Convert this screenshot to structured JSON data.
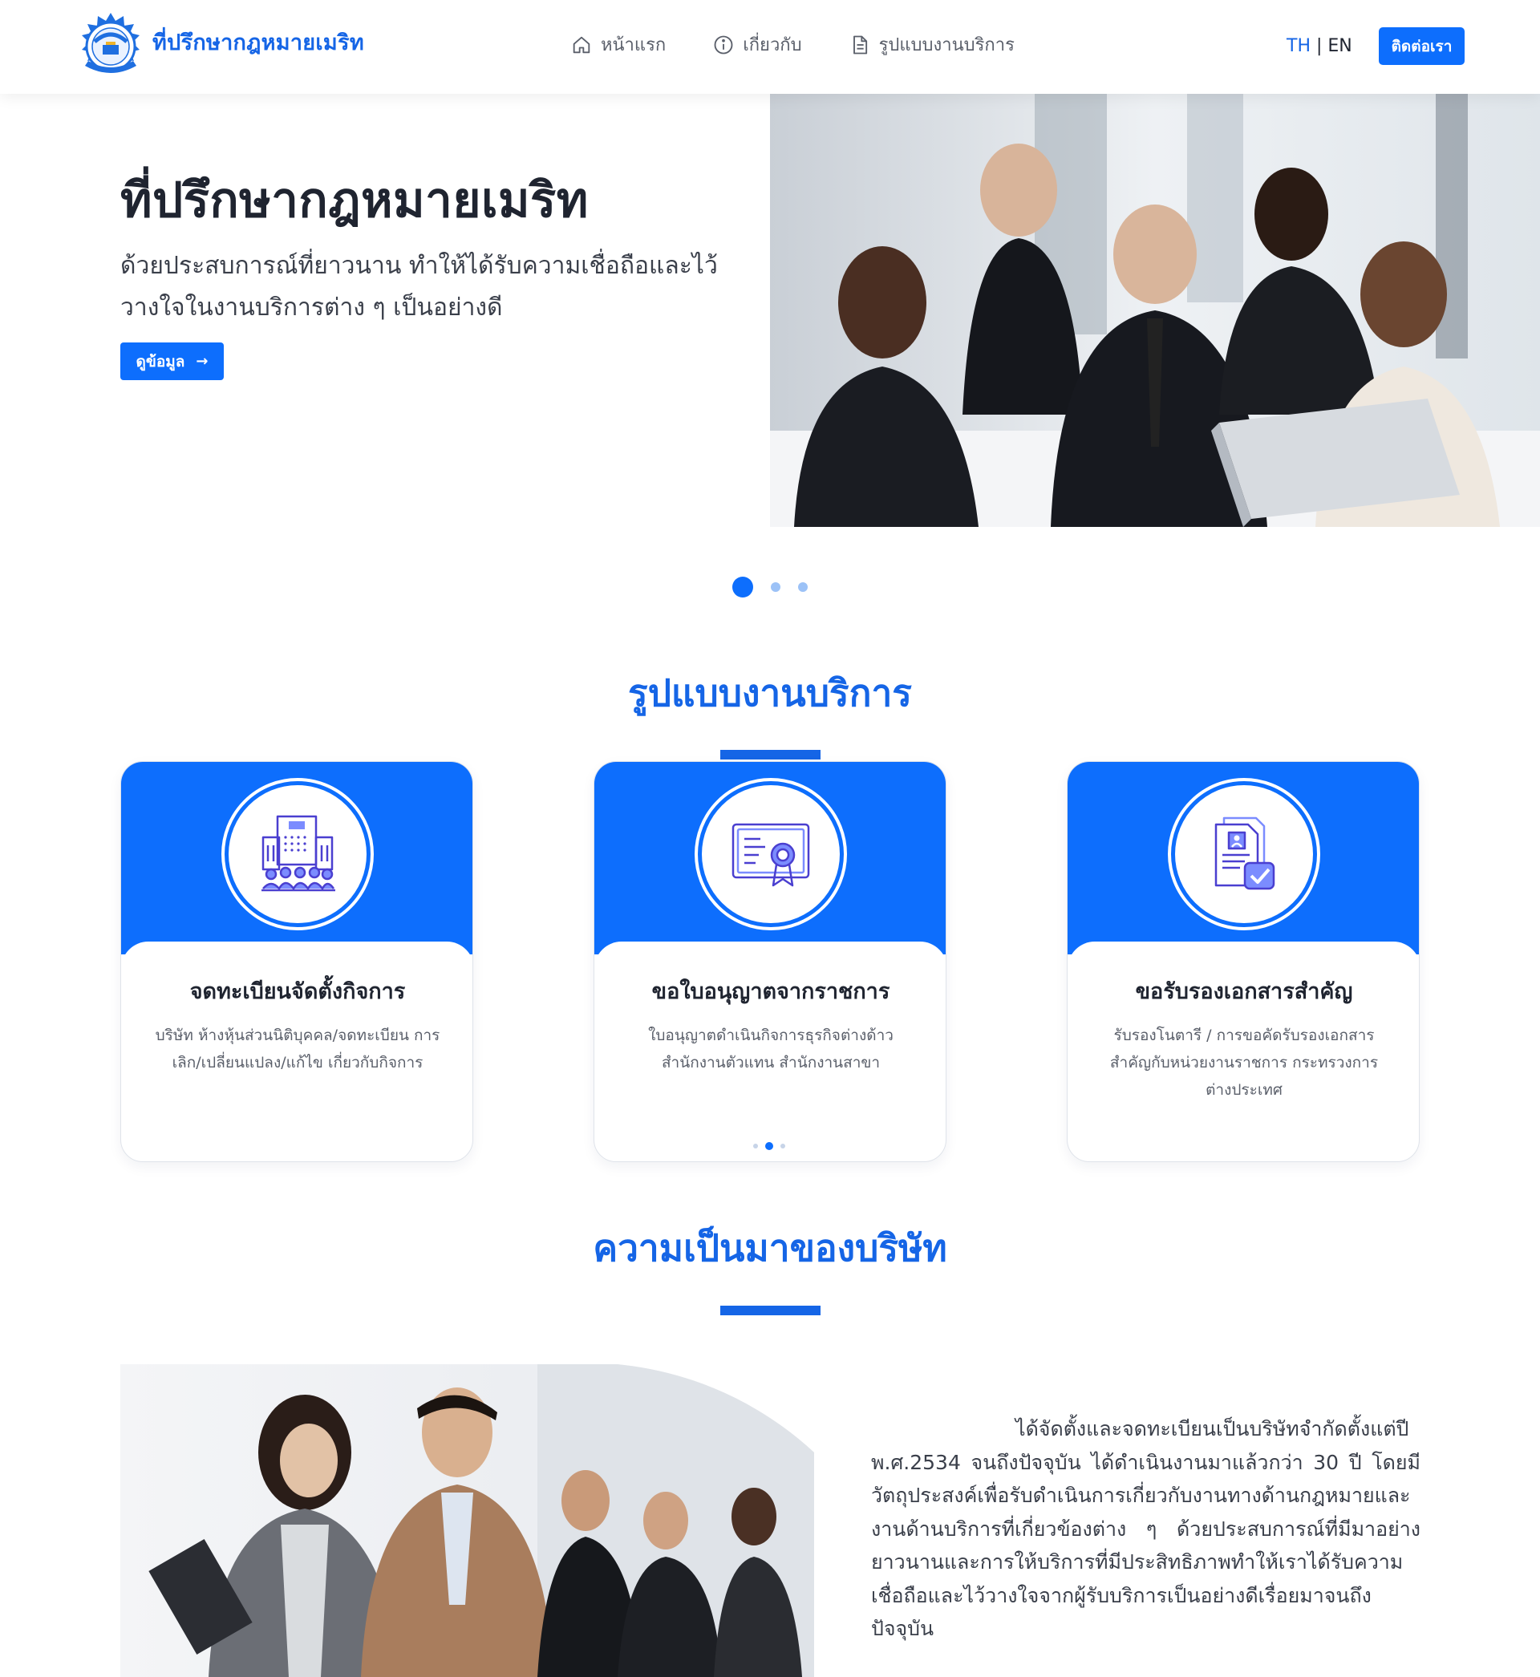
{
  "brand": {
    "name": "ที่ปรึกษากฎหมายเมริท"
  },
  "nav": {
    "items": [
      {
        "label": "หน้าแรก",
        "icon": "home-icon"
      },
      {
        "label": "เกี่ยวกับ",
        "icon": "info-icon"
      },
      {
        "label": "รูปแบบงานบริการ",
        "icon": "document-icon"
      }
    ],
    "lang_th": "TH",
    "lang_sep": "|",
    "lang_en": "EN",
    "contact_label": "ติดต่อเรา"
  },
  "hero": {
    "title": "ที่ปรึกษากฎหมายเมริท",
    "subtitle": "ด้วยประสบการณ์ที่ยาวนาน ทำให้ได้รับความเชื่อถือและไว้วางใจในงานบริการต่าง ๆ เป็นอย่างดี",
    "button_label": "ดูข้อมูล",
    "button_icon": "arrow-right-icon",
    "slides": 3,
    "active_slide": 1
  },
  "services": {
    "title": "รูปแบบงานบริการ",
    "cards": [
      {
        "title": "จดทะเบียนจัดตั้งกิจการ",
        "description": "บริษัท ห้างหุ้นส่วนนิติบุคคล/จดทะเบียน การเลิก/เปลี่ยนแปลง/แก้ไข เกี่ยวกับกิจการ",
        "icon": "company-building-icon"
      },
      {
        "title": "ขอใบอนุญาตจากราชการ",
        "description": "ใบอนุญาตดำเนินกิจการธุรกิจต่างด้าว สำนักงานตัวแทน สำนักงานสาขา",
        "icon": "certificate-icon"
      },
      {
        "title": "ขอรับรองเอกสารสำคัญ",
        "description": "รับรองโนตารี / การขอคัดรับรองเอกสารสำคัญกับหน่วยงานราชการ กระทรวงการต่างประเทศ",
        "icon": "document-approved-icon"
      }
    ],
    "pager": {
      "count": 3,
      "active": 2
    }
  },
  "about": {
    "title": "ความเป็นมาของบริษัท",
    "text": "ได้จัดตั้งและจดทะเบียนเป็นบริษัทจำกัดตั้งแต่ปี พ.ศ.2534 จนถึงปัจจุบัน ได้ดำเนินงานมาแล้วกว่า 30 ปี โดยมีวัตถุประสงค์เพื่อรับดำเนินการเกี่ยวกับงานทางด้านกฎหมายและงานด้านบริการที่เกี่ยวข้องต่าง ๆ ด้วยประสบการณ์ที่มีมาอย่างยาวนานและการให้บริการที่มีประสิทธิภาพทำให้เราได้รับความเชื่อถือและไว้วางใจจากผู้รับบริการเป็นอย่างดีเรื่อยมาจนถึงปัจจุบัน"
  },
  "colors": {
    "primary": "#0d6efd",
    "heading_blue": "#1565e6",
    "text_dark": "#1f2430",
    "text_muted": "#5a5f6a"
  }
}
